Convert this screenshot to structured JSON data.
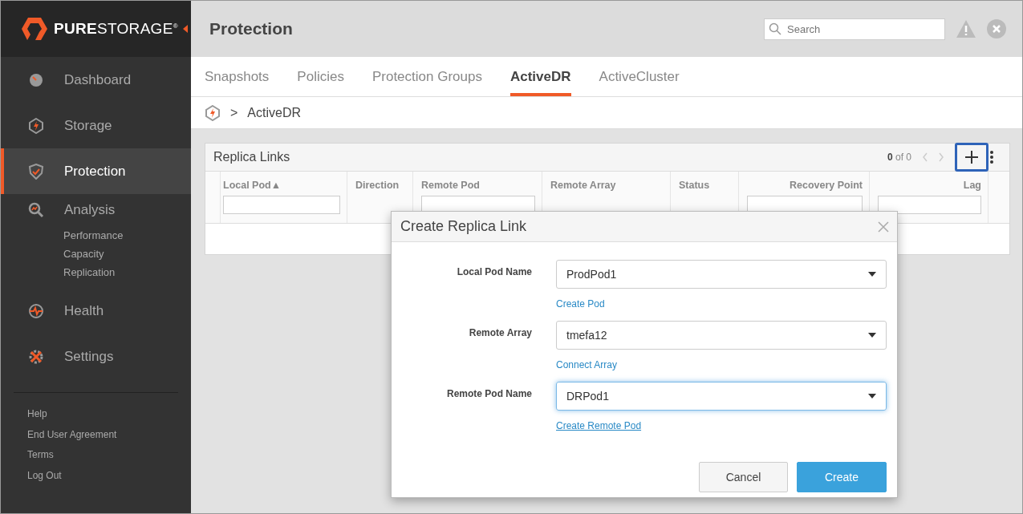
{
  "logo": {
    "text": "**PURE**STORAGE$^{®}$"
  },
  "sidebar": {
    "items": [
      {
        "label": "Dashboard",
        "selected": false
      },
      {
        "label": "Storage",
        "selected": false
      },
      {
        "label": "Protection",
        "selected": true
      },
      {
        "label": "Analysis",
        "selected": false,
        "children": [
          {
            "label": "Performance"
          },
          {
            "label": "Capacity"
          },
          {
            "label": "Replication"
          }
        ]
      },
      {
        "label": "Health",
        "selected": false
      },
      {
        "label": "Settings",
        "selected": false
      }
    ],
    "footer_links": [
      "Help",
      "End User Agreement",
      "Terms",
      "Log Out"
    ]
  },
  "header": {
    "title": "Protection",
    "search": {
      "placeholder": "Search"
    }
  },
  "tabs": [
    {
      "label": "Snapshots",
      "selected": false
    },
    {
      "label": "Policies",
      "selected": false
    },
    {
      "label": "Protection Groups",
      "selected": false
    },
    {
      "label": "ActiveDR",
      "selected": true
    },
    {
      "label": "ActiveCluster",
      "selected": false
    }
  ],
  "breadcrumb": {
    "separator": ">",
    "current": "ActiveDR"
  },
  "panel": {
    "title": "Replica Links",
    "count_bold": "0",
    "count_rest": "of 0",
    "add_highlighted": true,
    "columns": [
      {
        "label": "Local Pod▲",
        "kind": "filter"
      },
      {
        "label": "Direction",
        "kind": "plain"
      },
      {
        "label": "Remote Pod",
        "kind": "filter"
      },
      {
        "label": "Remote Array",
        "kind": "plain"
      },
      {
        "label": "Status",
        "kind": "plain"
      },
      {
        "label": "Recovery Point",
        "kind": "filter"
      },
      {
        "label": "Lag",
        "kind": "filter"
      }
    ]
  },
  "dialog": {
    "title": "Create Replica Link",
    "fields": [
      {
        "label": "Local Pod Name",
        "value": "ProdPod1",
        "focused": false,
        "link": "Create Pod",
        "link_hovered": false
      },
      {
        "label": "Remote Array",
        "value": "tmefa12",
        "focused": false,
        "link": "Connect Array",
        "link_hovered": false
      },
      {
        "label": "Remote Pod Name",
        "value": "DRPod1",
        "focused": true,
        "link": "Create Remote Pod",
        "link_hovered": true
      }
    ],
    "buttons": [
      {
        "label": "Cancel",
        "kind": "secondary"
      },
      {
        "label": "Create",
        "kind": "primary"
      }
    ]
  }
}
